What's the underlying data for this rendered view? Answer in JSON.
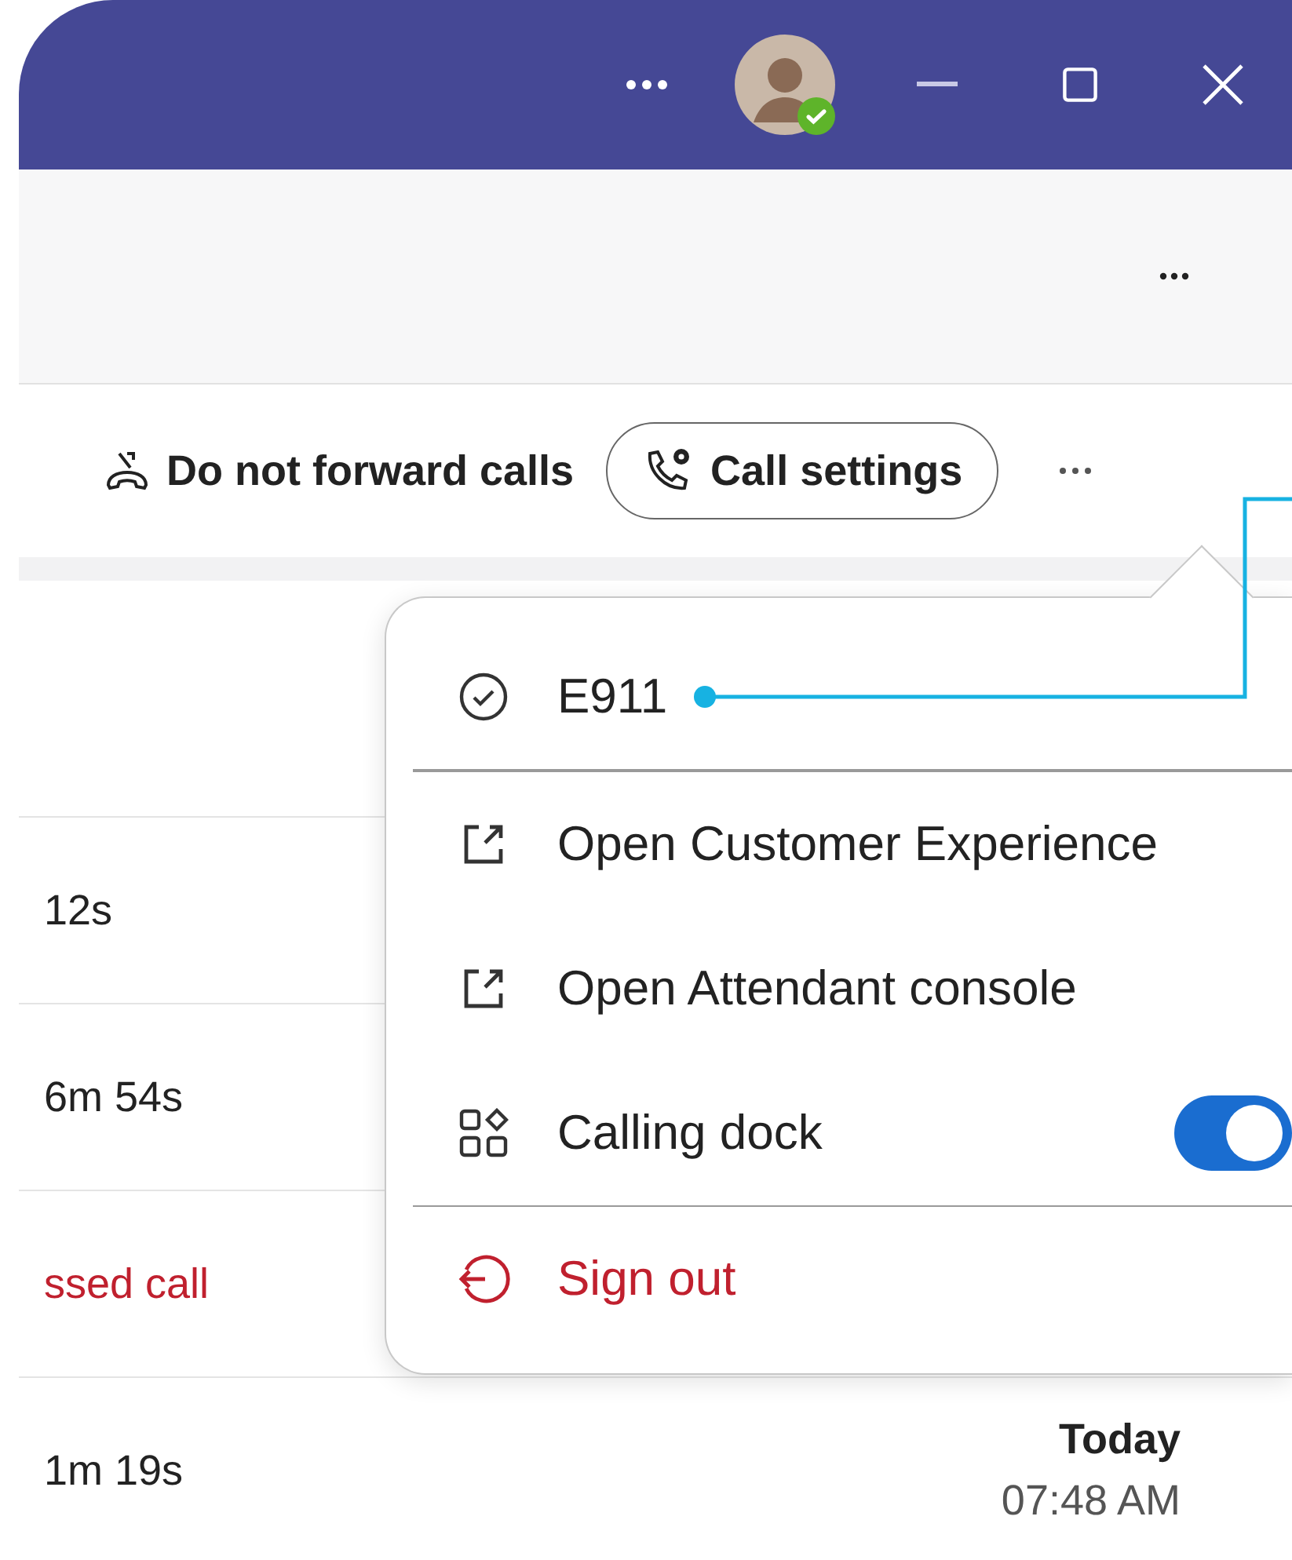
{
  "title_bar": {
    "online": true
  },
  "toolbar": {
    "forward_label": "Do not forward calls",
    "call_settings": "Call settings"
  },
  "calls": [
    {
      "text": "12s",
      "missed": false
    },
    {
      "text": "6m 54s",
      "missed": false
    },
    {
      "text": "ssed call",
      "missed": true
    },
    {
      "text": "1m 19s",
      "missed": false,
      "date": "Today",
      "time": "07:48 AM"
    }
  ],
  "menu": {
    "items": [
      {
        "kind": "status",
        "label": "E911",
        "callout": true
      },
      {
        "kind": "divider"
      },
      {
        "kind": "external",
        "label": "Open Customer Experience"
      },
      {
        "kind": "external",
        "label": "Open Attendant console"
      },
      {
        "kind": "toggle",
        "label": "Calling dock",
        "on": true
      },
      {
        "kind": "divider"
      },
      {
        "kind": "signout",
        "label": "Sign out"
      }
    ]
  }
}
